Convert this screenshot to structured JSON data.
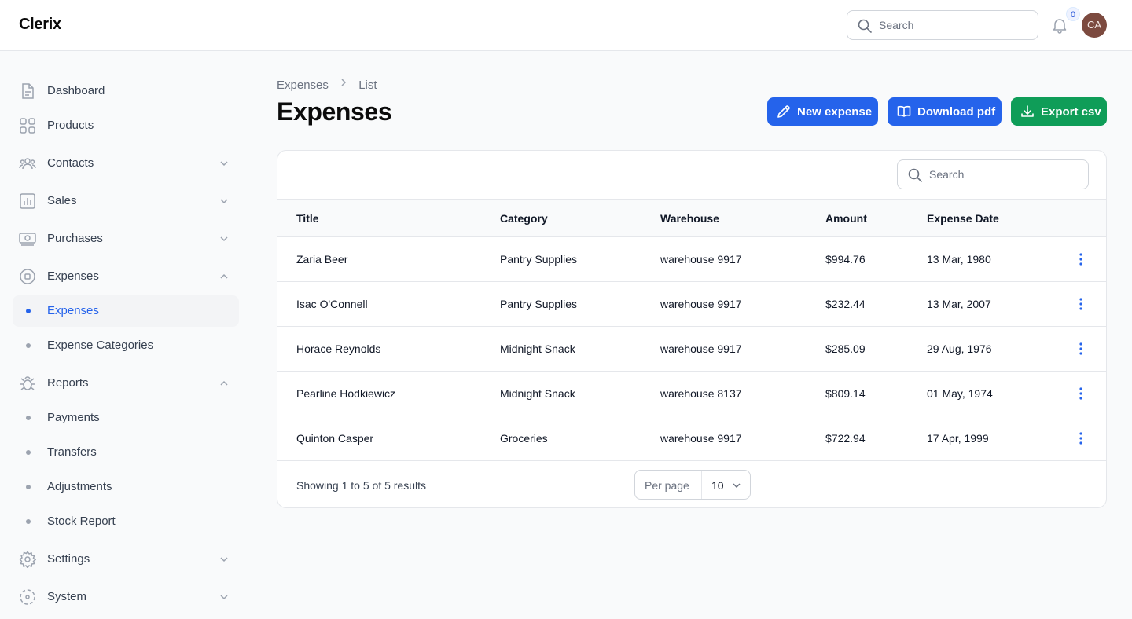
{
  "app": {
    "brand": "Clerix"
  },
  "topbar": {
    "search_placeholder": "Search",
    "notifications_count": "0",
    "avatar_initials": "CA"
  },
  "sidebar": {
    "items": [
      {
        "label": "Dashboard",
        "icon": "document-icon"
      },
      {
        "label": "Products",
        "icon": "grid-icon"
      },
      {
        "label": "Contacts",
        "icon": "users-icon"
      },
      {
        "label": "Sales",
        "icon": "chart-icon"
      },
      {
        "label": "Purchases",
        "icon": "money-icon"
      },
      {
        "label": "Expenses",
        "icon": "circle-square-icon"
      },
      {
        "label": "Reports",
        "icon": "bug-icon"
      },
      {
        "label": "Settings",
        "icon": "gear-icon"
      },
      {
        "label": "System",
        "icon": "dashed-circle-icon"
      }
    ],
    "expenses_sub": [
      "Expenses",
      "Expense Categories"
    ],
    "reports_sub": [
      "Payments",
      "Transfers",
      "Adjustments",
      "Stock Report"
    ]
  },
  "breadcrumb": {
    "parent": "Expenses",
    "current": "List"
  },
  "page": {
    "title": "Expenses"
  },
  "actions": {
    "new_expense": "New expense",
    "download_pdf": "Download pdf",
    "export_csv": "Export csv"
  },
  "colors": {
    "primary": "#2563eb",
    "success": "#0f9d58"
  },
  "table": {
    "search_placeholder": "Search",
    "columns": [
      "Title",
      "Category",
      "Warehouse",
      "Amount",
      "Expense Date"
    ],
    "rows": [
      {
        "title": "Zaria Beer",
        "category": "Pantry Supplies",
        "warehouse": "warehouse 9917",
        "amount": "$994.76",
        "date": "13 Mar, 1980"
      },
      {
        "title": "Isac O'Connell",
        "category": "Pantry Supplies",
        "warehouse": "warehouse 9917",
        "amount": "$232.44",
        "date": "13 Mar, 2007"
      },
      {
        "title": "Horace Reynolds",
        "category": "Midnight Snack",
        "warehouse": "warehouse 9917",
        "amount": "$285.09",
        "date": "29 Aug, 1976"
      },
      {
        "title": "Pearline Hodkiewicz",
        "category": "Midnight Snack",
        "warehouse": "warehouse 8137",
        "amount": "$809.14",
        "date": "01 May, 1974"
      },
      {
        "title": "Quinton Casper",
        "category": "Groceries",
        "warehouse": "warehouse 9917",
        "amount": "$722.94",
        "date": "17 Apr, 1999"
      }
    ],
    "summary": "Showing 1 to 5 of 5 results",
    "per_page_label": "Per page",
    "per_page_value": "10"
  }
}
